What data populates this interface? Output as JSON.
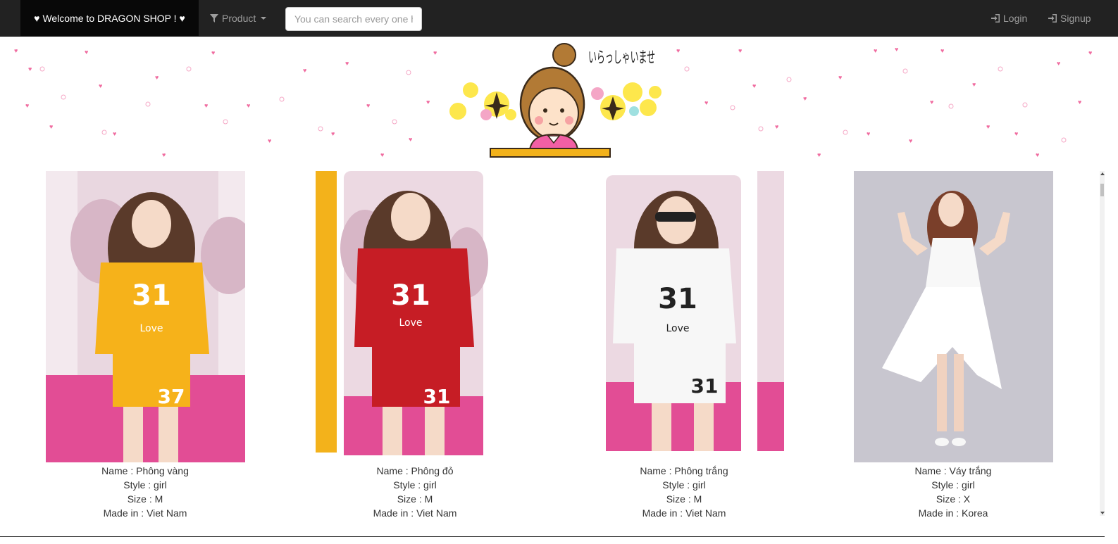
{
  "navbar": {
    "brand": "Welcome to DRAGON SHOP !",
    "product_menu": "Product",
    "search_placeholder": "You can search every one here",
    "login": "Login",
    "signup": "Signup"
  },
  "banner": {
    "greeting": "いらっしゃいませ"
  },
  "products": [
    {
      "name": "Name : Phông vàng",
      "style": "Style : girl",
      "size": "Size : M",
      "made_in": "Made in : Viet Nam"
    },
    {
      "name": "Name : Phông đỏ",
      "style": "Style : girl",
      "size": "Size : M",
      "made_in": "Made in : Viet Nam"
    },
    {
      "name": "Name : Phông trắng",
      "style": "Style : girl",
      "size": "Size : M",
      "made_in": "Made in : Viet Nam"
    },
    {
      "name": "Name : Váy trắng",
      "style": "Style : girl",
      "size": "Size : X",
      "made_in": "Made in : Korea"
    }
  ],
  "colors": {
    "navbar": "#222222",
    "brand_bg": "#080808",
    "nav_text": "#9d9d9d",
    "hearts": "#f06ca0"
  },
  "icons": {
    "brand": "heart-icon",
    "product": "filter-icon",
    "login": "log-in-icon",
    "signup": "log-in-icon"
  }
}
